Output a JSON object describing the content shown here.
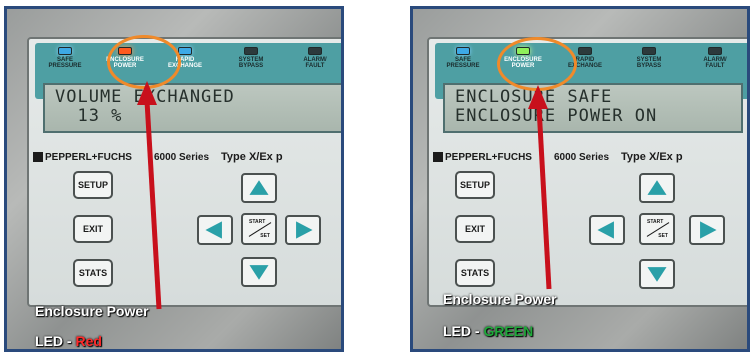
{
  "panels": [
    {
      "indicators": [
        {
          "label": "SAFE\nPRESSURE",
          "state": "blue"
        },
        {
          "label": "ENCLOSURE\nPOWER",
          "state": "red"
        },
        {
          "label": "RAPID\nEXCHANGE",
          "state": "blue"
        },
        {
          "label": "SYSTEM\nBYPASS",
          "state": "off"
        },
        {
          "label": "ALARM/\nFAULT",
          "state": "off"
        }
      ],
      "display": {
        "line1": "VOLUME EXCHANGED",
        "line2": "  13 %"
      },
      "brand": {
        "maker": "PEPPERL+FUCHS",
        "series": "6000 Series",
        "type": "Type X/Ex p"
      },
      "buttons": {
        "setup": "SETUP",
        "exit": "EXIT",
        "stats": "STATS",
        "start": "START",
        "set": "SET"
      },
      "caption": {
        "line1": "Enclosure Power",
        "line2_prefix": "LED - ",
        "line2_value": "Red",
        "value_color": "#ff2a2a"
      },
      "arrow_color": "#c8101c",
      "circle_color": "#f08a2a"
    },
    {
      "indicators": [
        {
          "label": "SAFE\nPRESSURE",
          "state": "blue"
        },
        {
          "label": "ENCLOSURE\nPOWER",
          "state": "green"
        },
        {
          "label": "RAPID\nEXCHANGE",
          "state": "off"
        },
        {
          "label": "SYSTEM\nBYPASS",
          "state": "off"
        },
        {
          "label": "ALARM/\nFAULT",
          "state": "off"
        }
      ],
      "display": {
        "line1": "ENCLOSURE SAFE",
        "line2": "ENCLOSURE POWER ON"
      },
      "brand": {
        "maker": "PEPPERL+FUCHS",
        "series": "6000 Series",
        "type": "Type X/Ex p"
      },
      "buttons": {
        "setup": "SETUP",
        "exit": "EXIT",
        "stats": "STATS",
        "start": "START",
        "set": "SET"
      },
      "caption": {
        "line1": "Enclosure Power",
        "line2_prefix": "LED - ",
        "line2_value": "GREEN",
        "value_color": "#1fa83a"
      },
      "arrow_color": "#c8101c",
      "circle_color": "#f08a2a"
    }
  ]
}
